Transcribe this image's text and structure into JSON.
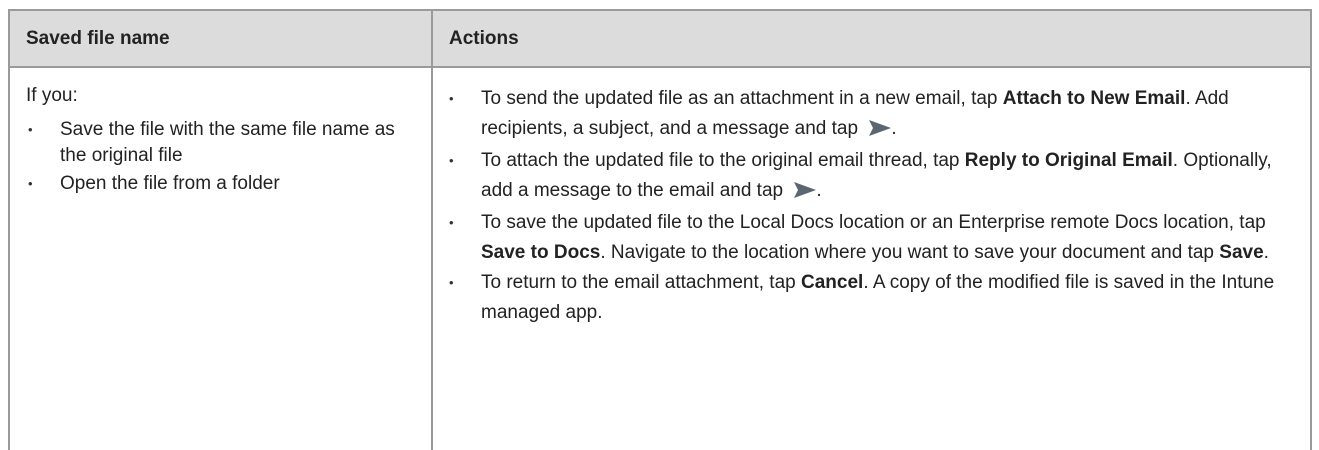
{
  "table": {
    "headers": {
      "saved_file_name": "Saved file name",
      "actions": "Actions"
    },
    "row": {
      "intro": "If you:",
      "conditions": [
        "Save the file with the same file name as the original file",
        "Open the file from a folder"
      ],
      "actions": [
        {
          "pre": "To send the updated file as an attachment in a new email, tap ",
          "bold1": "Attach to New Email",
          "mid": ". Add recipients, a subject, and a message and tap ",
          "icon": "send-icon",
          "post": "."
        },
        {
          "pre": "To attach the updated file to the original email thread, tap ",
          "bold1": "Reply to Original Email",
          "mid": ". Optionally, add a message to the email and tap ",
          "icon": "send-icon",
          "post": "."
        },
        {
          "pre": "To save the updated file to the Local Docs location or an Enterprise remote Docs location, tap ",
          "bold1": "Save to Docs",
          "mid": ". Navigate to the location where you want to save your document and tap ",
          "bold2": "Save",
          "post": "."
        },
        {
          "pre": "To return to the email attachment, tap ",
          "bold1": "Cancel",
          "mid": ". A copy of the modified file is saved in the Intune managed app."
        }
      ]
    }
  },
  "colors": {
    "header_bg": "#dcdcdc",
    "border": "#9a9a9a",
    "send_icon": "#5c6670"
  }
}
